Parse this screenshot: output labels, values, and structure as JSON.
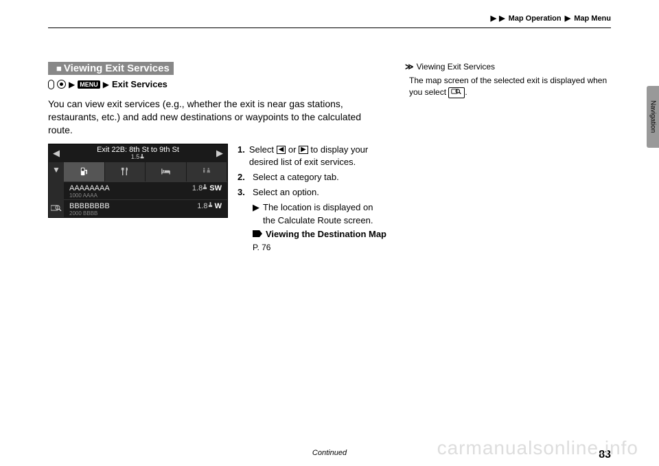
{
  "header": {
    "breadcrumb_sep": "▶",
    "breadcrumb1": "Map Operation",
    "breadcrumb2": "Map Menu",
    "side_tab": "Navigation"
  },
  "section": {
    "heading_prefix": "■",
    "heading": "Viewing Exit Services",
    "path": {
      "menu_label": "MENU",
      "sep": "▶",
      "target": "Exit Services"
    },
    "body": "You can view exit services (e.g., whether the exit is near gas stations, restaurants, etc.) and add new destinations or waypoints to the calculated route."
  },
  "nav_screen": {
    "left_arrow": "◀",
    "right_arrow": "▶",
    "exit_title": "Exit 22B: 8th St to 9th St",
    "exit_dist": "1.5",
    "down_arrow": "▼",
    "tabs": {
      "fuel_icon": "fuel",
      "food_icon": "food",
      "lodging_icon": "lodging",
      "rest_icon": "rest"
    },
    "rows": [
      {
        "name": "AAAAAAAA",
        "sub": "1000 AAAA",
        "dist": "1.8",
        "dir": "SW"
      },
      {
        "name": "BBBBBBBB",
        "sub": "2000 BBBB",
        "dist": "1.8",
        "dir": "W"
      }
    ]
  },
  "steps": {
    "s1": {
      "num": "1.",
      "text_a": "Select ",
      "btn1": "◀",
      "or": " or ",
      "btn2": "▶",
      "text_b": " to display your desired list of exit services."
    },
    "s2": {
      "num": "2.",
      "text": "Select a category tab."
    },
    "s3": {
      "num": "3.",
      "text": "Select an option."
    },
    "sub": {
      "marker": "▶",
      "text": "The location is displayed on the Calculate Route screen."
    },
    "ref": {
      "marker": "gg",
      "title": "Viewing the Destination Map",
      "page": "P. 76"
    }
  },
  "sidebar": {
    "marker": "≫",
    "title": "Viewing Exit Services",
    "body_a": "The map screen of the selected exit is displayed when you select ",
    "body_b": "."
  },
  "footer": {
    "continued": "Continued",
    "page": "83"
  },
  "watermark": "carmanualsonline.info"
}
